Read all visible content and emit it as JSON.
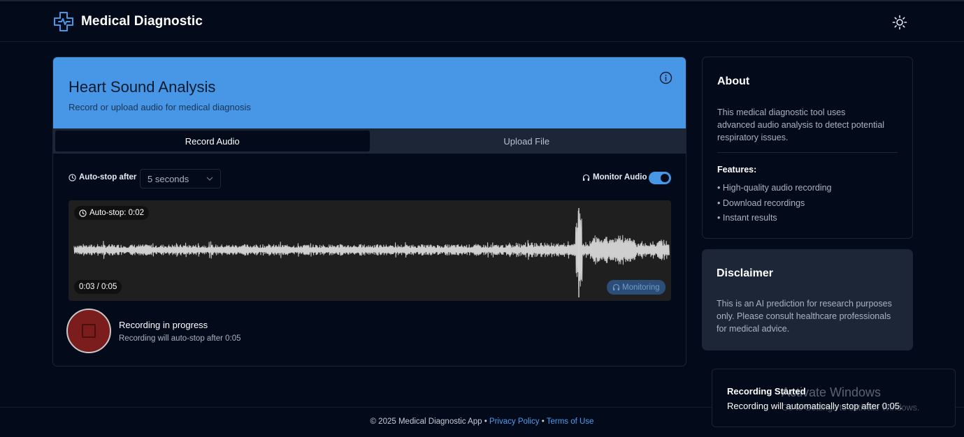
{
  "app": {
    "title": "Medical Diagnostic"
  },
  "main": {
    "title": "Heart Sound Analysis",
    "subtitle": "Record or upload audio for medical diagnosis",
    "tabs": [
      {
        "label": "Record Audio",
        "active": true
      },
      {
        "label": "Upload File",
        "active": false
      }
    ],
    "auto_stop_label": "Auto-stop after",
    "auto_stop_value": "5 seconds",
    "monitor_label": "Monitor Audio",
    "monitor_enabled": true,
    "wave": {
      "auto_stop_badge": "Auto-stop: 0:02",
      "time": "0:03 / 0:05",
      "monitoring_badge": "Monitoring"
    },
    "recording": {
      "title": "Recording in progress",
      "subtitle": "Recording will auto-stop after 0:05"
    }
  },
  "about": {
    "title": "About",
    "description": "This medical diagnostic tool uses advanced audio analysis to detect potential respiratory issues.",
    "features_label": "Features:",
    "features": [
      "• High-quality audio recording",
      "• Download recordings",
      "• Instant results"
    ]
  },
  "disclaimer": {
    "title": "Disclaimer",
    "text": "This is an AI prediction for research purposes only. Please consult healthcare professionals for medical advice."
  },
  "footer": {
    "copyright": "© 2025 Medical Diagnostic App",
    "sep": " • ",
    "privacy": "Privacy Policy",
    "terms": "Terms of Use"
  },
  "toast": {
    "title": "Recording Started",
    "message": "Recording will automatically stop after 0:05."
  },
  "watermark": {
    "title": "Activate Windows",
    "subtitle": "Go to Settings to activate Windows."
  },
  "colors": {
    "accent": "#4797e6",
    "background": "#030a1a",
    "record": "#7b1d1d"
  }
}
